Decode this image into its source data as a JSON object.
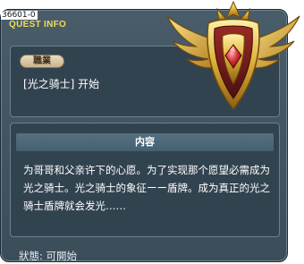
{
  "quest_id": "36601-0",
  "window_title": "QUEST INFO",
  "job": {
    "label": "職業",
    "value": "[光之骑士] 开始"
  },
  "content": {
    "header": "内容",
    "text": "为哥哥和父亲许下的心愿。为了实现那个愿望必需成为光之骑士。光之骑士的象征ーー盾牌。成为真正的光之骑士盾牌就会发光……"
  },
  "status": "狀態: 可開始",
  "emblem": {
    "icon": "winged-shield-emblem-icon",
    "colors": {
      "gold": "#e0b53a",
      "dark_red": "#7a1f1f",
      "gem": "#d8333a"
    }
  }
}
